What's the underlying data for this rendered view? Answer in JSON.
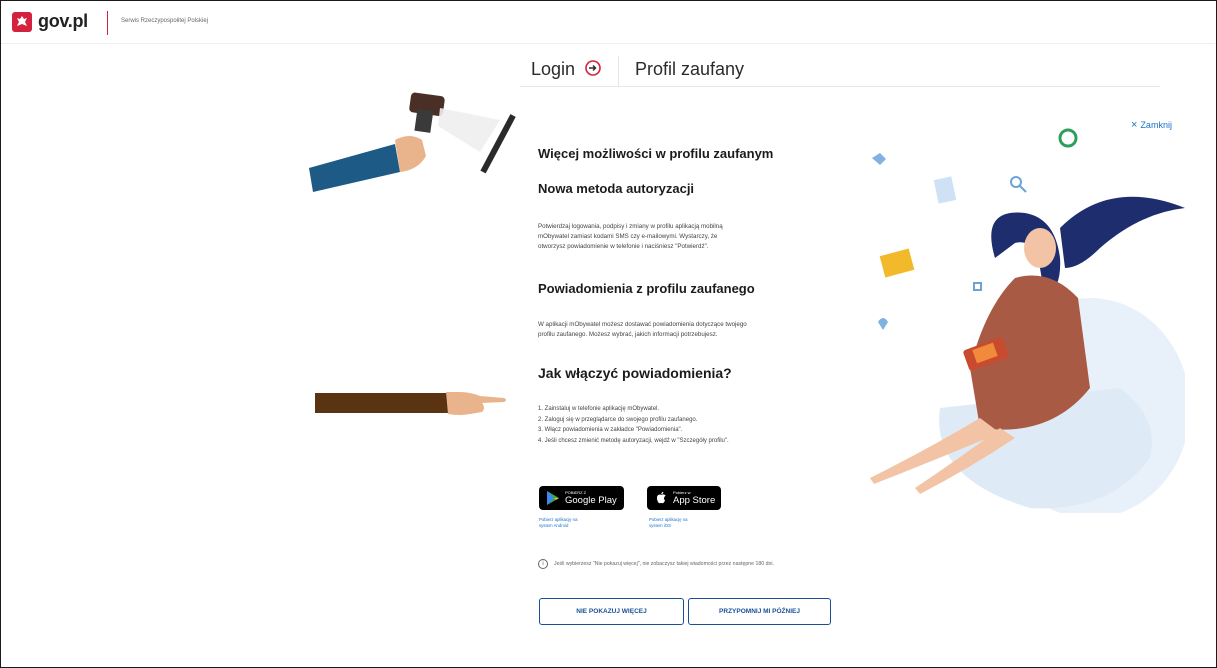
{
  "header": {
    "logo_text": "gov.pl",
    "subtitle": "Serwis Rzeczypospolitej Polskiej"
  },
  "tabs": [
    {
      "label": "Login"
    },
    {
      "label": "Profil zaufany"
    }
  ],
  "close": {
    "label": "Zamknij"
  },
  "content": {
    "title": "Więcej możliwości w profilu zaufanym",
    "section1": {
      "heading": "Nowa metoda autoryzacji",
      "lines": [
        "Potwierdzaj logowania, podpisy i zmiany w profilu aplikacją mobilną",
        "mObywatel zamiast kodami SMS czy e-mailowymi. Wystarczy, że",
        "otworzysz powiadomienie w telefonie i naciśniesz \"Potwierdź\"."
      ]
    },
    "section2": {
      "heading": "Powiadomienia z profilu zaufanego",
      "lines": [
        "W aplikacji mObywatel możesz dostawać powiadomienia dotyczące twojego",
        "profilu zaufanego. Możesz wybrać, jakich informacji potrzebujesz."
      ]
    },
    "section3": {
      "heading": "Jak włączyć powiadomienia?",
      "steps": [
        "1. Zainstaluj w telefonie aplikację mObywatel.",
        "2. Zaloguj się w przeglądarce do swojego profilu zaufanego.",
        "3. Włącz powiadomienia w zakładce \"Powiadomienia\".",
        "4. Jeśli chcesz zmienić metodę autoryzacji, wejdź w \"Szczegóły profilu\"."
      ]
    },
    "stores": {
      "google": {
        "small": "POBIERZ Z",
        "big": "Google Play",
        "caption": "Pobierz aplikację na system Android"
      },
      "apple": {
        "small": "Pobierz w",
        "big": "App Store",
        "caption": "Pobierz aplikację na system iOS"
      }
    },
    "info_text": "Jeśli wybierzesz \"Nie pokazuj więcej\", nie zobaczysz takiej wiadomości przez następne 180 dni.",
    "buttons": {
      "dont_show": "NIE POKAZUJ WIĘCEJ",
      "remind": "PRZYPOMNIJ MI PÓŹNIEJ"
    }
  },
  "colors": {
    "brand_red": "#d4213d",
    "link_blue": "#1a73c8",
    "button_blue": "#1a4f96"
  }
}
